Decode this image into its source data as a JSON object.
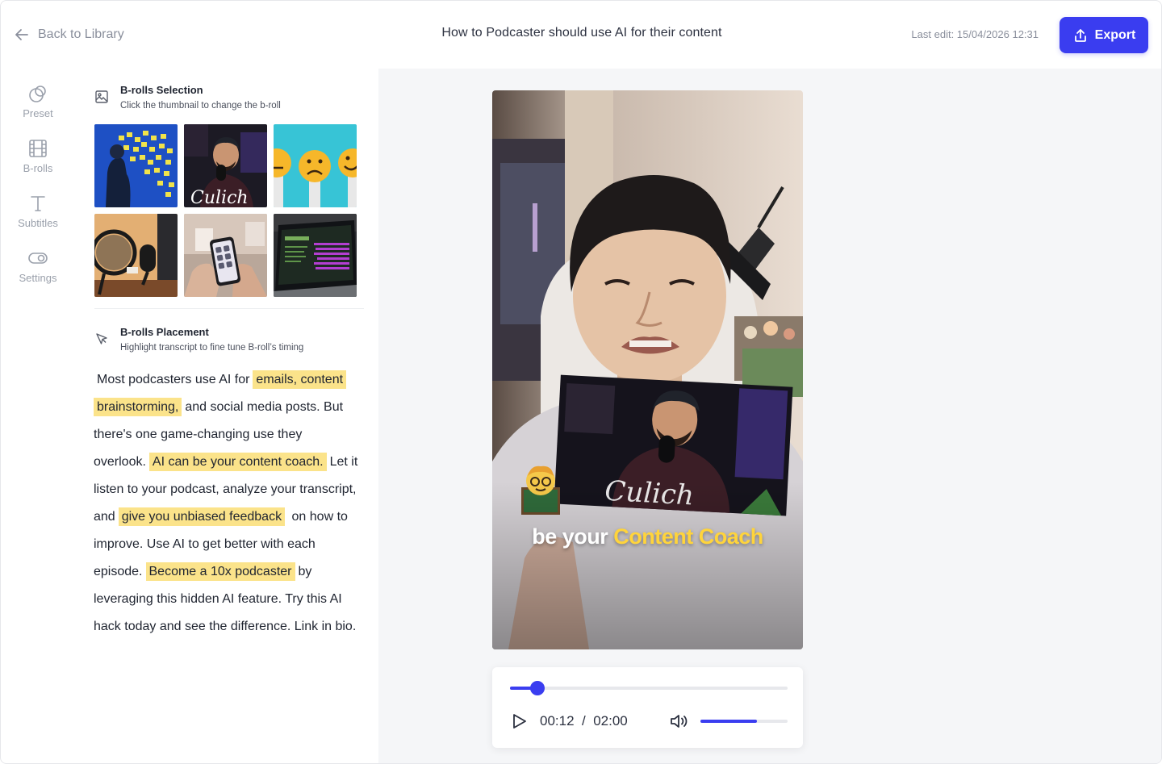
{
  "header": {
    "back_label": "Back to Library",
    "title": "How to Podcaster should use AI for their content",
    "last_edit": "Last edit: 15/04/2026 12:31",
    "export_label": "Export"
  },
  "rail": {
    "items": [
      {
        "label": "Preset",
        "icon": "preset-icon"
      },
      {
        "label": "B-rolls",
        "icon": "film-icon"
      },
      {
        "label": "Subtitles",
        "icon": "text-icon"
      },
      {
        "label": "Settings",
        "icon": "toggle-icon"
      }
    ]
  },
  "broll_selection": {
    "title": "B-rolls Selection",
    "subtitle": "Click the thumbnail to change the b-roll",
    "thumbnails": [
      "sticky-notes-wall",
      "podcaster-with-mic",
      "emoji-faces",
      "studio-microphone",
      "phone-in-hands",
      "laptop-screen"
    ]
  },
  "broll_placement": {
    "title": "B-rolls Placement",
    "subtitle": "Highlight transcript to fine tune B-roll’s timing"
  },
  "transcript": {
    "t1": "Most podcasters use AI for",
    "h1": "emails, content",
    "h2": "brainstorming,",
    "t2": "and social media posts. But there's one game-changing use they overlook.",
    "h3": "AI can be your content coach.",
    "t3": "Let it listen to your podcast, analyze your transcript, and",
    "h4": "give you unbiased feedback",
    "t4": "on how to improve. Use AI to get better with each episode.",
    "h5": "Become a 10x podcaster",
    "t5": "by leveraging this hidden AI feature. Try this AI hack today and see the difference. Link in bio."
  },
  "video": {
    "caption_white": "be your",
    "caption_accent": "Content Coach"
  },
  "player": {
    "current_time": "00:12",
    "separator": "/",
    "duration": "02:00",
    "progress": 0.1,
    "volume": 0.65
  },
  "colors": {
    "accent": "#3a3df0",
    "highlight": "#fbe38a",
    "caption_accent": "#ffd43b"
  }
}
